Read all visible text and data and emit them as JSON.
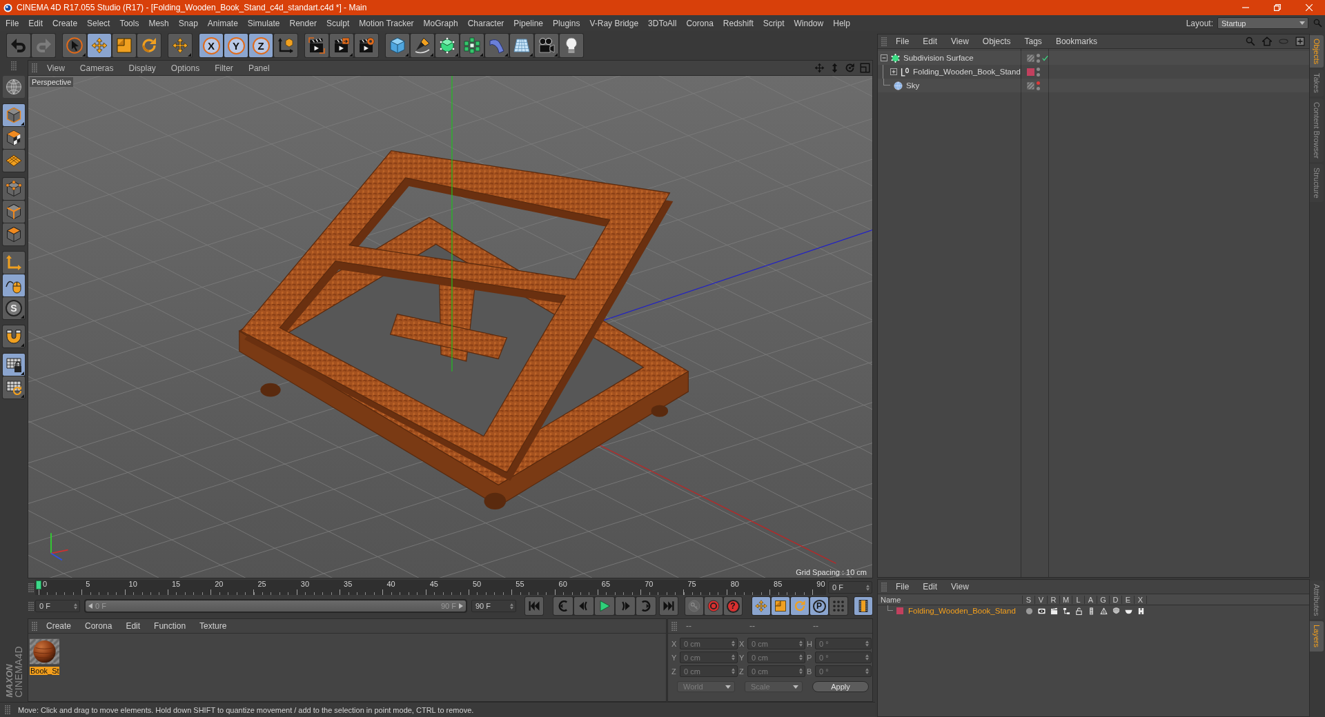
{
  "window": {
    "title": "CINEMA 4D R17.055 Studio (R17) - [Folding_Wooden_Book_Stand_c4d_standart.c4d *] - Main"
  },
  "menu_bar": [
    "File",
    "Edit",
    "Create",
    "Select",
    "Tools",
    "Mesh",
    "Snap",
    "Animate",
    "Simulate",
    "Render",
    "Sculpt",
    "Motion Tracker",
    "MoGraph",
    "Character",
    "Pipeline",
    "Plugins",
    "V-Ray Bridge",
    "3DToAll",
    "Corona",
    "Redshift",
    "Script",
    "Window",
    "Help"
  ],
  "layout": {
    "label": "Layout:",
    "value": "Startup"
  },
  "toolbar": [
    [
      {
        "kind": "undo",
        "disabled": false
      },
      {
        "kind": "redo",
        "disabled": true
      }
    ],
    [
      {
        "kind": "select",
        "selected": false,
        "menu": true
      },
      {
        "kind": "move",
        "selected": true
      },
      {
        "kind": "scale",
        "selected": false
      },
      {
        "kind": "rotate",
        "selected": false
      }
    ],
    [
      {
        "kind": "transform",
        "selected": false,
        "menu": true
      }
    ],
    [
      {
        "kind": "axis",
        "label": "X",
        "selected": true
      },
      {
        "kind": "axis",
        "label": "Y",
        "selected": true
      },
      {
        "kind": "axis",
        "label": "Z",
        "selected": true
      },
      {
        "kind": "coordinates",
        "selected": false
      }
    ],
    [
      {
        "kind": "renderview"
      },
      {
        "kind": "renderpicture",
        "menu": true
      },
      {
        "kind": "rendersettings"
      }
    ],
    [
      {
        "kind": "cube",
        "menu": true
      },
      {
        "kind": "pen",
        "menu": true
      },
      {
        "kind": "subdivision",
        "menu": true
      },
      {
        "kind": "cloner",
        "menu": true
      },
      {
        "kind": "deformer",
        "menu": true
      },
      {
        "kind": "floor",
        "menu": true
      },
      {
        "kind": "camera",
        "menu": true
      },
      {
        "kind": "light"
      }
    ]
  ],
  "modes": [
    [
      {
        "kind": "layout"
      }
    ],
    [
      {
        "kind": "model",
        "selected": true,
        "menu": true
      },
      {
        "kind": "texture",
        "selected": false
      },
      {
        "kind": "workplane",
        "selected": false
      }
    ],
    [
      {
        "kind": "points",
        "selected": false
      },
      {
        "kind": "edges",
        "selected": false
      },
      {
        "kind": "polygons",
        "selected": false
      }
    ],
    [
      {
        "kind": "axismode",
        "selected": false
      },
      {
        "kind": "tweak",
        "selected": true
      },
      {
        "kind": "solo",
        "label": "S",
        "selected": false,
        "menu": true
      }
    ],
    [
      {
        "kind": "snap",
        "selected": false,
        "menu": true
      }
    ],
    [
      {
        "kind": "lock",
        "selected": true,
        "menu": true
      },
      {
        "kind": "planar",
        "selected": false,
        "menu": true
      }
    ]
  ],
  "logo": {
    "brand": "MAXON",
    "product": "CINEMA4D"
  },
  "viewport": {
    "menu": [
      "View",
      "Cameras",
      "Display",
      "Options",
      "Filter",
      "Panel"
    ],
    "camera": "Perspective",
    "grid_spacing": "Grid Spacing : 10 cm"
  },
  "timeline": {
    "labels": [
      "0",
      "5",
      "10",
      "15",
      "20",
      "25",
      "30",
      "35",
      "40",
      "45",
      "50",
      "55",
      "60",
      "65",
      "70",
      "75",
      "80",
      "85",
      "90"
    ],
    "level": 0,
    "current_frame": "0 F"
  },
  "transport": {
    "start": "0 F",
    "range": {
      "start": "0 F",
      "end": "90 F",
      "level": 1
    },
    "end": "90 F"
  },
  "record": [
    {
      "kind": "key",
      "disabled": true
    },
    {
      "kind": "autokey",
      "disabled": false
    },
    {
      "kind": "keymode",
      "label": "?",
      "disabled": false
    }
  ],
  "tracks": [
    {
      "kind": "position",
      "selected": true
    },
    {
      "kind": "scale",
      "selected": true
    },
    {
      "kind": "rotation",
      "selected": true
    },
    {
      "kind": "parameter",
      "label": "P",
      "selected": true
    },
    {
      "kind": "pla",
      "selected": false
    }
  ],
  "timeline_button": {
    "selected": true
  },
  "materials": {
    "menu": [
      "Create",
      "Corona",
      "Edit",
      "Function",
      "Texture"
    ],
    "items": [
      {
        "name": "Book_St",
        "selected": true
      }
    ]
  },
  "coordinates": {
    "headers": [
      "--",
      "--",
      "--"
    ],
    "rows": [
      [
        {
          "axis": "X",
          "value": "0 cm"
        },
        {
          "axis": "X",
          "value": "0 cm"
        },
        {
          "axis": "H",
          "value": "0 °"
        }
      ],
      [
        {
          "axis": "Y",
          "value": "0 cm"
        },
        {
          "axis": "Y",
          "value": "0 cm"
        },
        {
          "axis": "P",
          "value": "0 °"
        }
      ],
      [
        {
          "axis": "Z",
          "value": "0 cm"
        },
        {
          "axis": "Z",
          "value": "0 cm"
        },
        {
          "axis": "B",
          "value": "0 °"
        }
      ]
    ],
    "mode": "World",
    "size_mode": "Scale",
    "apply": "Apply"
  },
  "status_bar": {
    "text": "Move: Click and drag to move elements. Hold down SHIFT to quantize movement / add to the selection in point mode, CTRL to remove."
  },
  "object_manager": {
    "menu": [
      "File",
      "Edit",
      "View",
      "Objects",
      "Tags",
      "Bookmarks"
    ],
    "objects": [
      {
        "kind": "subdivision",
        "name": "Subdivision Surface",
        "expanded": true,
        "editor_visible": true,
        "render_visible": true,
        "enabled": true,
        "children": [
          {
            "kind": "null",
            "name": "Folding_Wooden_Book_Stand",
            "expanded": false,
            "color": "#c2405e",
            "editor_visible": true,
            "render_visible": true
          }
        ]
      },
      {
        "kind": "sky",
        "name": "Sky",
        "editor_visible": false,
        "render_visible": true
      }
    ]
  },
  "layers": {
    "menu": [
      "File",
      "Edit",
      "View"
    ],
    "columns": [
      "Name",
      "S",
      "V",
      "R",
      "M",
      "L",
      "A",
      "G",
      "D",
      "E",
      "X"
    ],
    "rows": [
      {
        "name": "Folding_Wooden_Book_Stand",
        "color": "#c2405e",
        "selected": true
      }
    ]
  },
  "side_tabs": [
    [
      {
        "label": "Objects",
        "selected": true
      },
      {
        "label": "Takes",
        "selected": false
      },
      {
        "label": "Content Browser",
        "selected": false
      },
      {
        "label": "Structure",
        "selected": false
      }
    ],
    [
      {
        "label": "Attributes",
        "selected": false
      },
      {
        "label": "Layers",
        "selected": true
      }
    ]
  ]
}
